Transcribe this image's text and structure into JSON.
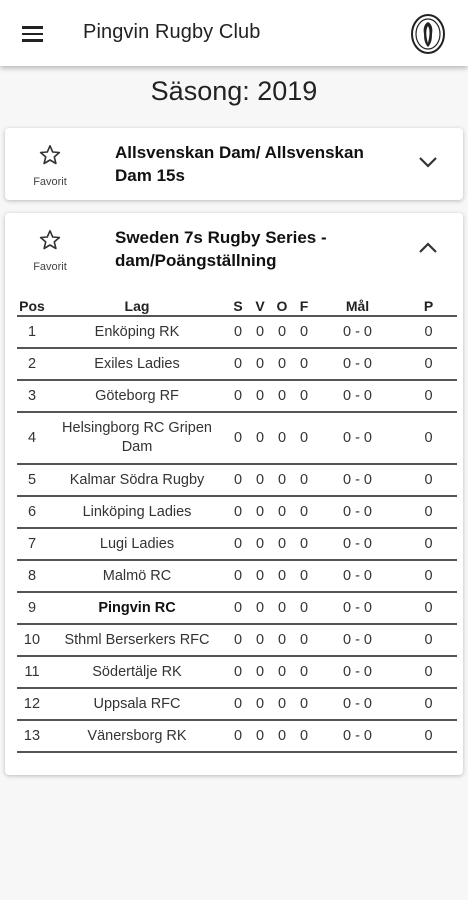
{
  "header": {
    "title": "Pingvin Rugby Club",
    "menu_icon": "hamburger-menu-icon",
    "logo_icon": "club-logo-icon"
  },
  "season": {
    "label": "Säsong: 2019"
  },
  "competitions": [
    {
      "name": "Allsvenskan Dam/ Allsvenskan Dam 15s",
      "favorite_label": "Favorit",
      "expanded": false
    },
    {
      "name": "Sweden 7s Rugby Series - dam/Poängställning",
      "favorite_label": "Favorit",
      "expanded": true
    }
  ],
  "standings": {
    "headers": {
      "pos": "Pos",
      "team": "Lag",
      "s": "S",
      "v": "V",
      "o": "O",
      "f": "F",
      "goals": "Mål",
      "points": "P"
    },
    "rows": [
      {
        "pos": "1",
        "team": "Enköping RK",
        "s": "0",
        "v": "0",
        "o": "0",
        "f": "0",
        "goals": "0 - 0",
        "points": "0"
      },
      {
        "pos": "2",
        "team": "Exiles Ladies",
        "s": "0",
        "v": "0",
        "o": "0",
        "f": "0",
        "goals": "0 - 0",
        "points": "0"
      },
      {
        "pos": "3",
        "team": "Göteborg RF",
        "s": "0",
        "v": "0",
        "o": "0",
        "f": "0",
        "goals": "0 - 0",
        "points": "0"
      },
      {
        "pos": "4",
        "team": "Helsingborg RC Gripen Dam",
        "s": "0",
        "v": "0",
        "o": "0",
        "f": "0",
        "goals": "0 - 0",
        "points": "0"
      },
      {
        "pos": "5",
        "team": "Kalmar Södra Rugby",
        "s": "0",
        "v": "0",
        "o": "0",
        "f": "0",
        "goals": "0 - 0",
        "points": "0"
      },
      {
        "pos": "6",
        "team": "Linköping Ladies",
        "s": "0",
        "v": "0",
        "o": "0",
        "f": "0",
        "goals": "0 - 0",
        "points": "0"
      },
      {
        "pos": "7",
        "team": "Lugi Ladies",
        "s": "0",
        "v": "0",
        "o": "0",
        "f": "0",
        "goals": "0 - 0",
        "points": "0"
      },
      {
        "pos": "8",
        "team": "Malmö RC",
        "s": "0",
        "v": "0",
        "o": "0",
        "f": "0",
        "goals": "0 - 0",
        "points": "0"
      },
      {
        "pos": "9",
        "team": "Pingvin RC",
        "s": "0",
        "v": "0",
        "o": "0",
        "f": "0",
        "goals": "0 - 0",
        "points": "0"
      },
      {
        "pos": "10",
        "team": "Sthml Berserkers RFC",
        "s": "0",
        "v": "0",
        "o": "0",
        "f": "0",
        "goals": "0 - 0",
        "points": "0"
      },
      {
        "pos": "11",
        "team": "Södertälje RK",
        "s": "0",
        "v": "0",
        "o": "0",
        "f": "0",
        "goals": "0 - 0",
        "points": "0"
      },
      {
        "pos": "12",
        "team": "Uppsala RFC",
        "s": "0",
        "v": "0",
        "o": "0",
        "f": "0",
        "goals": "0 - 0",
        "points": "0"
      },
      {
        "pos": "13",
        "team": "Vänersborg RK",
        "s": "0",
        "v": "0",
        "o": "0",
        "f": "0",
        "goals": "0 - 0",
        "points": "0"
      }
    ]
  }
}
